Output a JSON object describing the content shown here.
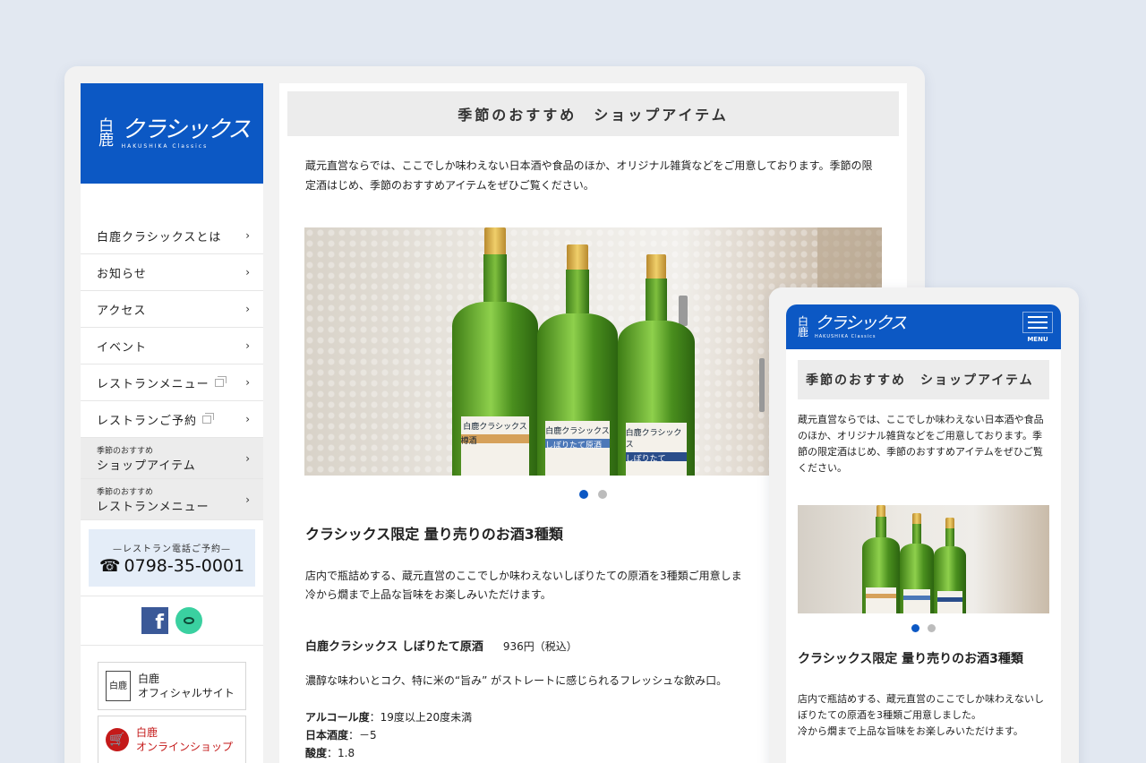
{
  "brand": {
    "logo_kanji": "白鹿",
    "logo_katakana": "クラシックス",
    "logo_english": "HAKUSHIKA Classics"
  },
  "sidebar": {
    "nav": [
      {
        "label": "白鹿クラシックスとは"
      },
      {
        "label": "お知らせ"
      },
      {
        "label": "アクセス"
      },
      {
        "label": "イベント"
      },
      {
        "label": "レストランメニュー"
      },
      {
        "label": "レストランご予約"
      }
    ],
    "featured": [
      {
        "small": "季節のおすすめ",
        "big": "ショップアイテム"
      },
      {
        "small": "季節のおすすめ",
        "big": "レストランメニュー"
      }
    ],
    "phone_caption": "—レストラン電話ご予約—",
    "phone_number": "0798-35-0001",
    "banners": [
      {
        "seal": "白鹿",
        "line1": "白鹿",
        "line2": "オフィシャルサイト"
      },
      {
        "line1": "白鹿",
        "line2": "オンラインショップ"
      }
    ]
  },
  "content": {
    "section_title": "季節のおすすめ　ショップアイテム",
    "intro": "蔵元直営ならでは、ここでしか味わえない日本酒や食品のほか、オリジナル雑貨などをご用意しております。季節の限定酒はじめ、季節のおすすめアイテムをぜひご覧ください。",
    "bottle_labels": [
      "白鹿クラシックス",
      "白鹿クラシックス",
      "白鹿クラシックス"
    ],
    "bottle_sublabels": [
      "樽酒",
      "しぼりたて原酒",
      "しぼりたて"
    ],
    "heading": "クラシックス限定 量り売りのお酒3種類",
    "description_line1": "店内で瓶詰めする、蔵元直営のここでしか味わえないしぼりたての原酒を3種類ご用意しま",
    "description_line2": "冷から燗まで上品な旨味をお楽しみいただけます。",
    "product_name": "白鹿クラシックス しぼりたて原酒",
    "product_price": "936円（税込）",
    "product_desc": "濃醇な味わいとコク、特に米の“旨み” がストレートに感じられるフレッシュな飲み口。",
    "specs": [
      {
        "k": "アルコール度",
        "v": "：19度以上20度未満"
      },
      {
        "k": "日本酒度",
        "v": "：－5"
      },
      {
        "k": "酸度",
        "v": "：1.8"
      }
    ]
  },
  "mobile": {
    "menu_label": "MENU",
    "section_title": "季節のおすすめ　ショップアイテム",
    "intro": "蔵元直営ならでは、ここでしか味わえない日本酒や食品のほか、オリジナル雑貨などをご用意しております。季節の限定酒はじめ、季節のおすすめアイテムをぜひご覧ください。",
    "heading": "クラシックス限定 量り売りのお酒3種類",
    "description_line1": "店内で瓶詰めする、蔵元直営のここでしか味わえないしぼりたての原酒を3種類ご用意しました。",
    "description_line2": "冷から燗まで上品な旨味をお楽しみいただけます。"
  },
  "colors": {
    "brand_blue": "#0c58c4",
    "background": "#e2e8f1",
    "active_dot": "#0c58c4"
  }
}
